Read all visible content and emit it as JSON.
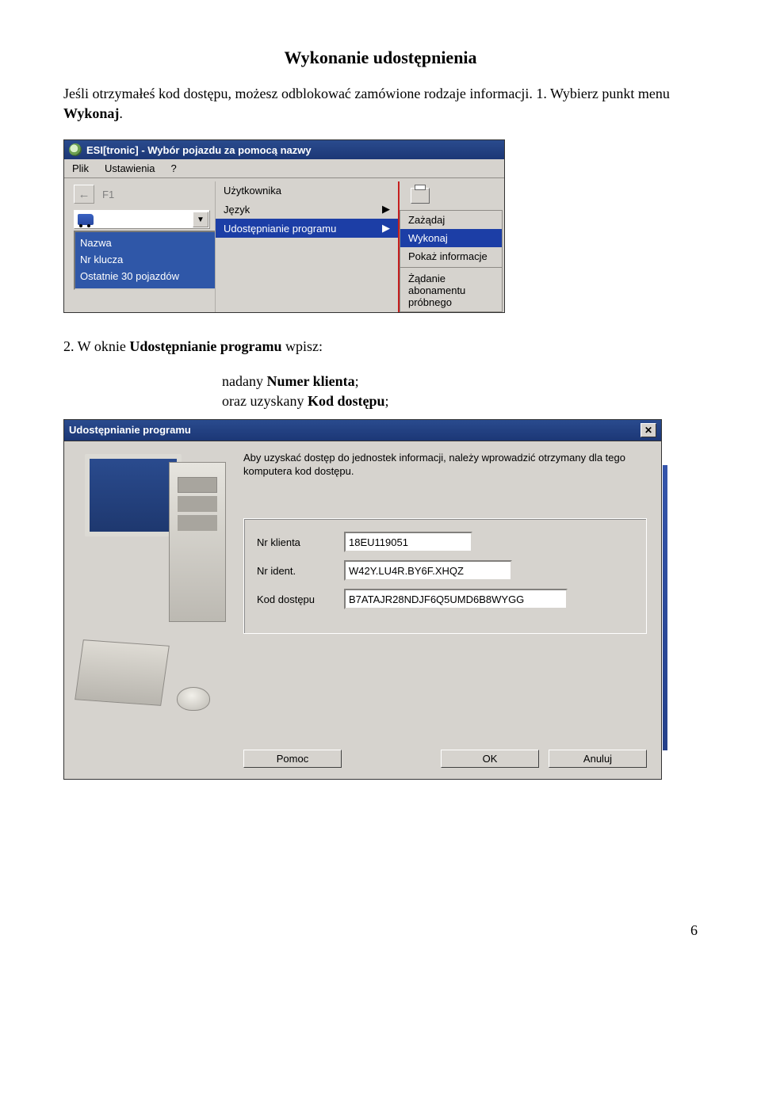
{
  "pageNumber": "6",
  "heading": "Wykonanie udostępnienia",
  "intro": {
    "text_before_bold": "Jeśli otrzymałeś kod dostępu, możesz odblokować zamówione rodzaje informacji.\n1. Wybierz punkt menu ",
    "bold": "Wykonaj",
    "after": "."
  },
  "step2": {
    "prefix": "2. W oknie ",
    "bold": "Udostępnianie programu",
    "suffix": " wpisz:",
    "line1_a": "nadany ",
    "line1_b_bold": "Numer klienta",
    "line1_c": ";",
    "line2_a": "oraz uzyskany ",
    "line2_b_bold": "Kod dostępu",
    "line2_c": ";"
  },
  "shot1": {
    "title": "ESI[tronic] - Wybór pojazdu za pomocą nazwy",
    "menubar": [
      "Plik",
      "Ustawienia",
      "?"
    ],
    "f1": "F1",
    "dropdown_menu": {
      "items": [
        "Użytkownika",
        "Język",
        "Udostępnianie programu"
      ],
      "selected_index": 2
    },
    "submenu": {
      "items": [
        "Zażądaj",
        "Wykonaj",
        "Pokaż informacje",
        "__sep__",
        "Żądanie abonamentu próbnego"
      ],
      "selected_index": 1
    },
    "listbox": [
      "Nazwa",
      "Nr klucza",
      "Ostatnie 30 pojazdów"
    ]
  },
  "shot2": {
    "title": "Udostępnianie programu",
    "instruction": "Aby uzyskać dostęp do jednostek informacji, należy wprowadzić otrzymany dla tego komputera kod dostępu.",
    "fields": {
      "klient_label": "Nr klienta",
      "klient_value": "18EU119051",
      "ident_label": "Nr ident.",
      "ident_value": "W42Y.LU4R.BY6F.XHQZ",
      "kod_label": "Kod dostępu",
      "kod_value": "B7ATAJR28NDJF6Q5UMD6B8WYGG"
    },
    "buttons": {
      "help": "Pomoc",
      "ok": "OK",
      "cancel": "Anuluj"
    }
  }
}
